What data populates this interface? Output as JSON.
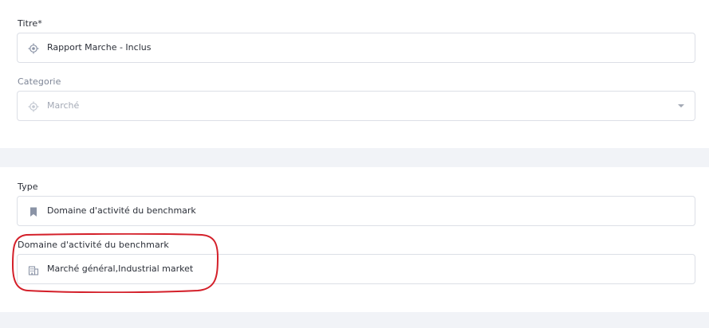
{
  "form": {
    "titre": {
      "label": "Titre*",
      "value": "Rapport Marche - Inclus",
      "icon": "target-icon"
    },
    "categorie": {
      "label": "Categorie",
      "value": "Marché",
      "icon": "target-icon"
    },
    "type": {
      "label": "Type",
      "value": "Domaine d'activité du benchmark",
      "icon": "bookmark-icon"
    },
    "domaine": {
      "label": "Domaine d'activité du benchmark",
      "value": "Marché général,Industrial market",
      "icon": "building-icon"
    }
  },
  "colors": {
    "accent_highlight": "#d4202a",
    "page_bg": "#f1f3f7",
    "border": "#dcdfe6",
    "icon": "#8a93a6"
  }
}
